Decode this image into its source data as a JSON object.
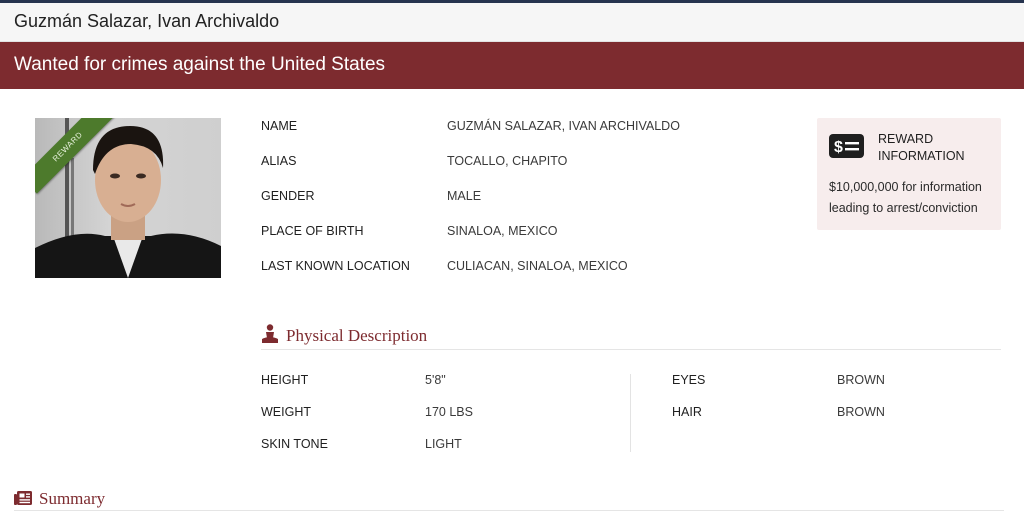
{
  "header": {
    "title": "Guzmán Salazar, Ivan Archivaldo"
  },
  "banner": {
    "text": "Wanted for crimes against the United States"
  },
  "photo": {
    "ribbon_label": "REWARD",
    "ribbon_color": "#4d7a2c"
  },
  "info": {
    "rows": [
      {
        "label": "NAME",
        "value": "GUZMÁN SALAZAR, IVAN ARCHIVALDO"
      },
      {
        "label": "ALIAS",
        "value": "TOCALLO, CHAPITO"
      },
      {
        "label": "GENDER",
        "value": "MALE"
      },
      {
        "label": "PLACE OF BIRTH",
        "value": "SINALOA, MEXICO"
      },
      {
        "label": "LAST KNOWN LOCATION",
        "value": "CULIACAN, SINALOA, MEXICO"
      }
    ]
  },
  "reward": {
    "icon": "dollar-bill-icon",
    "title": "REWARD INFORMATION",
    "description": "$10,000,000 for information leading to arrest/conviction"
  },
  "physical": {
    "heading": "Physical Description",
    "icon": "person-icon",
    "left": [
      {
        "label": "HEIGHT",
        "value": "5'8\""
      },
      {
        "label": "WEIGHT",
        "value": "170 LBS"
      },
      {
        "label": "SKIN TONE",
        "value": "LIGHT"
      }
    ],
    "right": [
      {
        "label": "EYES",
        "value": "BROWN"
      },
      {
        "label": "HAIR",
        "value": "BROWN"
      }
    ]
  },
  "summary": {
    "heading": "Summary",
    "icon": "newspaper-icon"
  },
  "colors": {
    "accent": "#7d2b2f",
    "reward_bg": "#f7eded",
    "topline": "#26344f"
  }
}
